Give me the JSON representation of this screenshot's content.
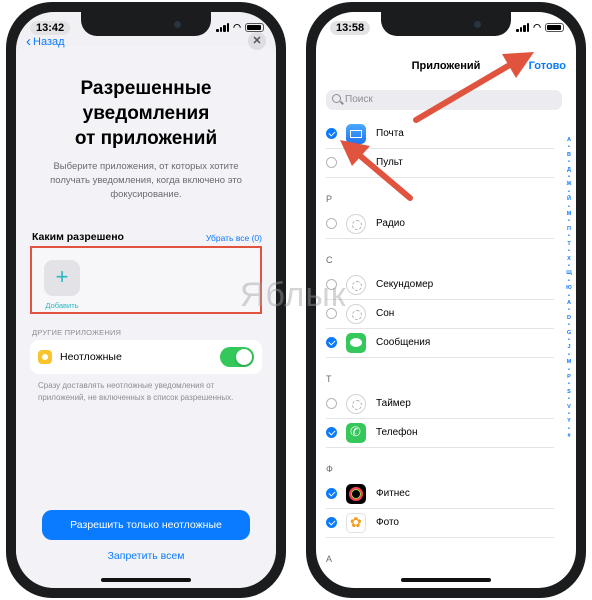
{
  "watermark": "Яблык",
  "left_phone": {
    "status_time": "13:42",
    "back_label": "Назад",
    "close_label": "✕",
    "title_line1": "Разрешенные",
    "title_line2": "уведомления",
    "title_line3": "от приложений",
    "subtitle": "Выберите приложения, от которых хотите получать уведомления, когда включено это фокусирование.",
    "allowed_header": "Каким разрешено",
    "clear_all": "Убрать все (0)",
    "add_icon": "+",
    "add_label": "Добавить",
    "other_apps_header": "ДРУГИЕ ПРИЛОЖЕНИЯ",
    "urgent_label": "Неотложные",
    "urgent_toggle_on": true,
    "urgent_note": "Сразу доставлять неотложные уведомления от приложений, не включенных в список разрешенных.",
    "primary_button": "Разрешить только неотложные",
    "secondary_button": "Запретить всем"
  },
  "right_phone": {
    "status_time": "13:58",
    "nav_title": "Приложений",
    "done_label": "Готово",
    "search_placeholder": "Поиск",
    "rows": [
      {
        "kind": "app",
        "label": "Почта",
        "checked": true,
        "icon": "mail-icon"
      },
      {
        "kind": "app",
        "label": "Пульт",
        "checked": false,
        "icon": "remote-icon"
      },
      {
        "kind": "header",
        "label": "Р"
      },
      {
        "kind": "app",
        "label": "Радио",
        "checked": false,
        "icon": "placeholder-gear-icon"
      },
      {
        "kind": "header",
        "label": "С"
      },
      {
        "kind": "app",
        "label": "Секундомер",
        "checked": false,
        "icon": "placeholder-gear-icon"
      },
      {
        "kind": "app",
        "label": "Сон",
        "checked": false,
        "icon": "placeholder-gear-icon"
      },
      {
        "kind": "app",
        "label": "Сообщения",
        "checked": true,
        "icon": "messages-icon"
      },
      {
        "kind": "header",
        "label": "Т"
      },
      {
        "kind": "app",
        "label": "Таймер",
        "checked": false,
        "icon": "placeholder-gear-icon"
      },
      {
        "kind": "app",
        "label": "Телефон",
        "checked": true,
        "icon": "phone-icon"
      },
      {
        "kind": "header",
        "label": "Ф"
      },
      {
        "kind": "app",
        "label": "Фитнес",
        "checked": true,
        "icon": "fitness-icon"
      },
      {
        "kind": "app",
        "label": "Фото",
        "checked": true,
        "icon": "photos-icon"
      },
      {
        "kind": "header",
        "label": "A"
      }
    ],
    "section_index": [
      "A",
      "•",
      "B",
      "•",
      "Д",
      "•",
      "Ж",
      "•",
      "Й",
      "•",
      "М",
      "•",
      "П",
      "•",
      "Т",
      "•",
      "Х",
      "•",
      "Щ",
      "•",
      "Ю",
      "•",
      "A",
      "•",
      "D",
      "•",
      "G",
      "•",
      "J",
      "•",
      "M",
      "•",
      "P",
      "•",
      "S",
      "•",
      "V",
      "•",
      "Y",
      "•",
      "#"
    ]
  },
  "colors": {
    "accent_blue": "#0a7aff",
    "toggle_green": "#34c759",
    "annotation_red": "#e0543f",
    "add_teal": "#28b8c2"
  }
}
